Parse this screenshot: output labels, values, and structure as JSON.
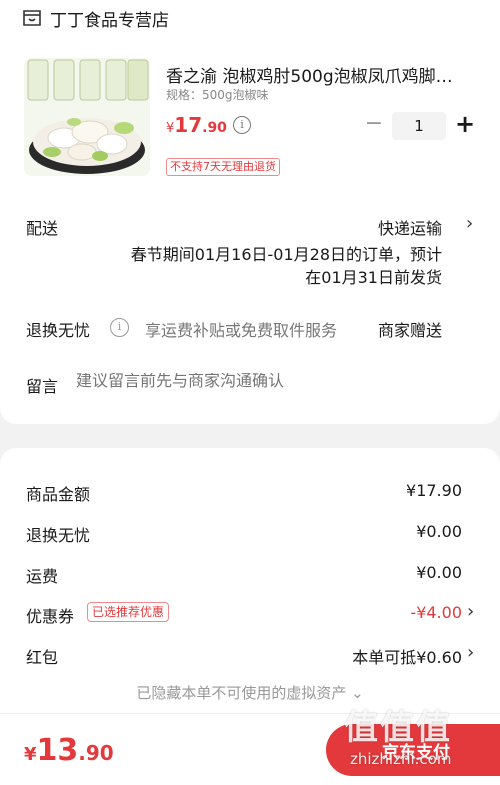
{
  "store": {
    "name": "丁丁食品专营店",
    "icon": "store-icon"
  },
  "product": {
    "title": "香之渝 泡椒鸡肘500g泡椒凤爪鸡脚…",
    "spec": "规格：500g泡椒味",
    "price_currency": "¥",
    "price_int": "17",
    "price_dec": ".90",
    "quantity": "1",
    "minus": "−",
    "plus": "+",
    "return_policy": "不支持7天无理由退货"
  },
  "shipping": {
    "label": "配送",
    "method": "快递运输",
    "note_line1": "春节期间01月16日-01月28日的订单，预计",
    "note_line2": "在01月31日前发货"
  },
  "returns": {
    "label": "退换无忧",
    "service": "享运费补贴或免费取件服务",
    "provider": "商家赠送"
  },
  "memo": {
    "label": "留言",
    "placeholder": "建议留言前先与商家沟通确认"
  },
  "summary": {
    "rows": [
      {
        "label": "商品金额",
        "value": "¥17.90"
      },
      {
        "label": "退换无忧",
        "value": "¥0.00"
      },
      {
        "label": "运费",
        "value": "¥0.00"
      },
      {
        "label": "优惠券",
        "badge": "已选推荐优惠",
        "value": "-¥4.00"
      },
      {
        "label": "红包",
        "value": "本单可抵¥0.60"
      }
    ],
    "hidden_assets": "已隐藏本单不可使用的虚拟资产 ⌄"
  },
  "footer": {
    "total_currency": "¥",
    "total_int": "13",
    "total_dec": ".90",
    "pay_label": "京东支付"
  },
  "watermark": {
    "glyphs": "值值值",
    "url": "zhizhizhi.com"
  },
  "colors": {
    "accent": "#e4393c",
    "background": "#f2f2f2"
  }
}
